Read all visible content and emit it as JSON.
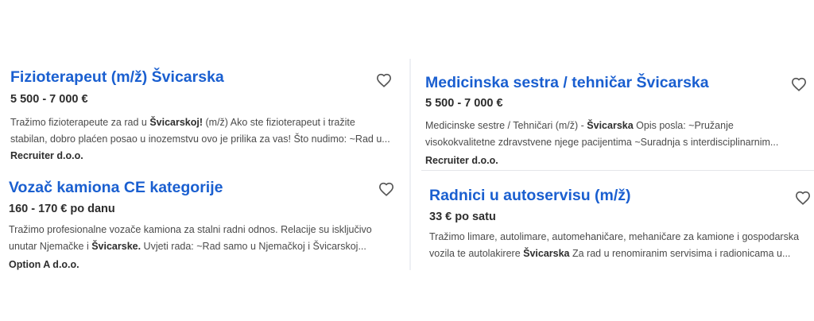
{
  "jobs": [
    {
      "title": "Fizioterapeut (m/ž) Švicarska",
      "salary": "5 500 - 7 000 €",
      "snippet_lines": [
        [
          {
            "text": "Tražimo fizioterapeute za rad u ",
            "bold": false
          },
          {
            "text": "Švicarskoj!",
            "bold": true
          },
          {
            "text": " (m/ž) Ako ste fizioterapeut i tražite",
            "bold": false
          }
        ],
        [
          {
            "text": "stabilan, dobro plaćen posao u inozemstvu ovo je prilika za vas! Što nudimo: ~Rad u...",
            "bold": false
          }
        ]
      ],
      "company": "Recruiter d.o.o.",
      "favorite_icon": "heart-outline-icon"
    },
    {
      "title": "Vozač kamiona CE kategorije",
      "salary": "160 - 170 € po danu",
      "snippet_lines": [
        [
          {
            "text": "Tražimo profesionalne vozače kamiona za stalni radni odnos. Relacije su isključivo",
            "bold": false
          }
        ],
        [
          {
            "text": "unutar Njemačke i ",
            "bold": false
          },
          {
            "text": "Švicarske.",
            "bold": true
          },
          {
            "text": " Uvjeti rada: ~Rad samo u Njemačkoj i Švicarskoj...",
            "bold": false
          }
        ]
      ],
      "company": "Option A d.o.o.",
      "favorite_icon": "heart-outline-icon"
    },
    {
      "title": "Medicinska sestra / tehničar Švicarska",
      "salary": "5 500 - 7 000 €",
      "snippet_lines": [
        [
          {
            "text": "Medicinske sestre / Tehničari (m/ž) - ",
            "bold": false
          },
          {
            "text": "Švicarska",
            "bold": true
          },
          {
            "text": " Opis posla: ~Pružanje",
            "bold": false
          }
        ],
        [
          {
            "text": "visokokvalitetne zdravstvene njege pacijentima ~Suradnja s interdisciplinarnim...",
            "bold": false
          }
        ]
      ],
      "company": "Recruiter d.o.o.",
      "favorite_icon": "heart-outline-icon"
    },
    {
      "title": "Radnici u autoservisu (m/ž)",
      "salary": "33 € po satu",
      "snippet_lines": [
        [
          {
            "text": "Tražimo limare, autolimare, automehaničare, mehaničare za kamione i gospodarska",
            "bold": false
          }
        ],
        [
          {
            "text": "vozila te autolakirere ",
            "bold": false
          },
          {
            "text": "Švicarska",
            "bold": true
          },
          {
            "text": " Za rad u renomiranim servisima i radionicama u...",
            "bold": false
          }
        ]
      ],
      "company": "",
      "favorite_icon": "heart-outline-icon"
    }
  ],
  "colors": {
    "title": "#1a5fd0",
    "text": "#2d2d2d",
    "snippet": "#4b4b4b",
    "icon": "#555555"
  }
}
